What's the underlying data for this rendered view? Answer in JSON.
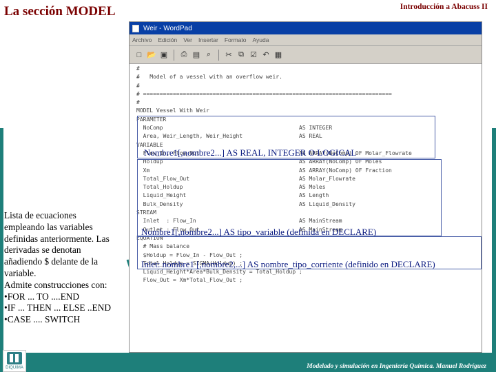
{
  "slide": {
    "title": "La sección MODEL",
    "course": "Introducción a Abacuss II",
    "footer": "Modelado y simulación en Ingeniería Química.  Manuel Rodríguez"
  },
  "logo": {
    "text": "DIQUIMA"
  },
  "left_note": {
    "lines": [
      "Lista de ecuaciones",
      "empleando las variables",
      "definidas anteriormente. Las",
      "derivadas se denotan",
      "añadiendo $ delante de la",
      "variable.",
      "Admite construcciones con:",
      "•FOR ... TO ....END",
      "•IF ... THEN ... ELSE ..END",
      "•CASE .... SWITCH"
    ]
  },
  "window": {
    "title": "Weir - WordPad",
    "menu": [
      "Archivo",
      "Edición",
      "Ver",
      "Insertar",
      "Formato",
      "Ayuda"
    ],
    "toolbar_icons": [
      "new-icon",
      "open-icon",
      "save-icon",
      "print-icon",
      "print-preview-icon",
      "find-icon",
      "cut-icon",
      "copy-icon",
      "paste-icon",
      "undo-icon",
      "insert-date-icon"
    ],
    "lines": [
      "#",
      "#   Model of a vessel with an overflow weir.",
      "#",
      "# ===========================================================================",
      "#",
      "MODEL Vessel With Weir",
      "",
      "PARAMETER",
      "  NoComp                                         AS INTEGER",
      "  Area, Weir_Length, Weir_Height                 AS REAL",
      "",
      "VARIABLE",
      "  Flow_In, Flow_Out                              AS ARRAY(NoComp) OF Molar_Flowrate",
      "  Holdup                                         AS ARRAY(NoComp) OF Moles",
      "  Xm                                             AS ARRAY(NoComp) OF Fraction",
      "  Total_Flow_Out                                 AS Molar_Flowrate",
      "  Total_Holdup                                   AS Moles",
      "  Liquid_Height                                  AS Length",
      "  Bulk_Density                                   AS Liquid_Density",
      "",
      "STREAM",
      "  Inlet  : Flow_In                               AS MainStream",
      "  Outlet : Flow_Out                              AS MainStream",
      "EQUATION",
      "",
      "  # Mass balance",
      "  $Holdup = Flow_In - Flow_Out ;",
      "",
      "  Total_Holdup = SIGMA(Holdup) ;",
      "",
      "  Liquid_Height*Area*Bulk_Density = Total_Holdup ;",
      "",
      "  Flow_Out = Xm*Total_Flow_Out ;"
    ]
  },
  "annotations": {
    "parameter": "Nombre1[,nombre2...]  AS REAL, INTEGER O LOGICAL",
    "variable": "Nombre1[,nombre2...]  AS tipo_variable (definida en DECLARE)",
    "stream": "Inlet: nombre1 [,nombre2,...]  AS nombre_tipo_corriente (definido en DECLARE)"
  },
  "colors": {
    "title": "#7a0000",
    "bars": "#1e7f7a",
    "annotation": "#0a1a80",
    "titlebar": "#083fa5"
  }
}
